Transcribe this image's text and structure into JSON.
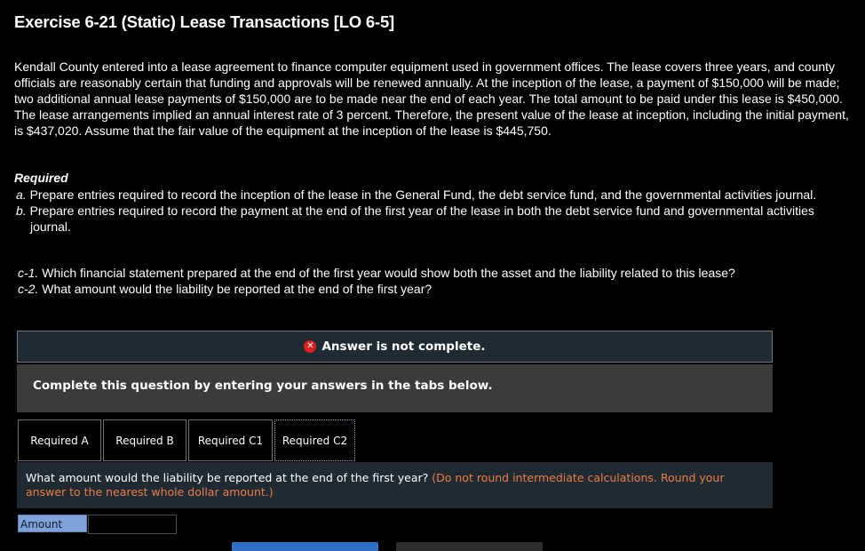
{
  "title": "Exercise 6-21 (Static) Lease Transactions [LO 6-5]",
  "intro": "Kendall County entered into a lease agreement to finance computer equipment used in government offices. The lease covers three years, and county officials are reasonably certain that funding and approvals will be renewed annually. At the inception of the lease, a payment of $150,000 will be made; two additional annual lease payments of $150,000 are to be made near the end of each year. The total amount to be paid under this lease is $450,000. The lease arrangements implied an annual interest rate of 3 percent. Therefore, the present value of the lease at inception, including the initial payment, is $437,020. Assume that the fair value of the equipment at the inception of the lease is $445,750.",
  "required": {
    "heading": "Required",
    "items": [
      {
        "letter": "a.",
        "text": "Prepare entries required to record the inception of the lease in the General Fund, the debt service fund, and the governmental activities journal."
      },
      {
        "letter": "b.",
        "text": "Prepare entries required to record the payment at the end of the first year of the lease in both the debt service fund and governmental activities journal."
      }
    ],
    "c_items": [
      {
        "letter": "c-1.",
        "text": "Which financial statement prepared at the end of the first year would show both the asset and the liability related to this lease?"
      },
      {
        "letter": "c-2.",
        "text": "What amount would the liability be reported at the end of the first year?"
      }
    ]
  },
  "answer_status": "Answer is not complete.",
  "instruction": "Complete this question by entering your answers in the tabs below.",
  "tabs": [
    {
      "label": "Required A"
    },
    {
      "label": "Required B"
    },
    {
      "label": "Required C1"
    },
    {
      "label": "Required C2"
    }
  ],
  "question": {
    "text": "What amount would the liability be reported at the end of the first year?",
    "hint": "(Do not round intermediate calculations. Round your answer to the nearest whole dollar amount.)"
  },
  "amount": {
    "label": "Amount",
    "value": ""
  },
  "colors": {
    "accent_blue": "#2f6fc4",
    "hint_orange": "#f07c45",
    "error_red": "#e02020"
  }
}
